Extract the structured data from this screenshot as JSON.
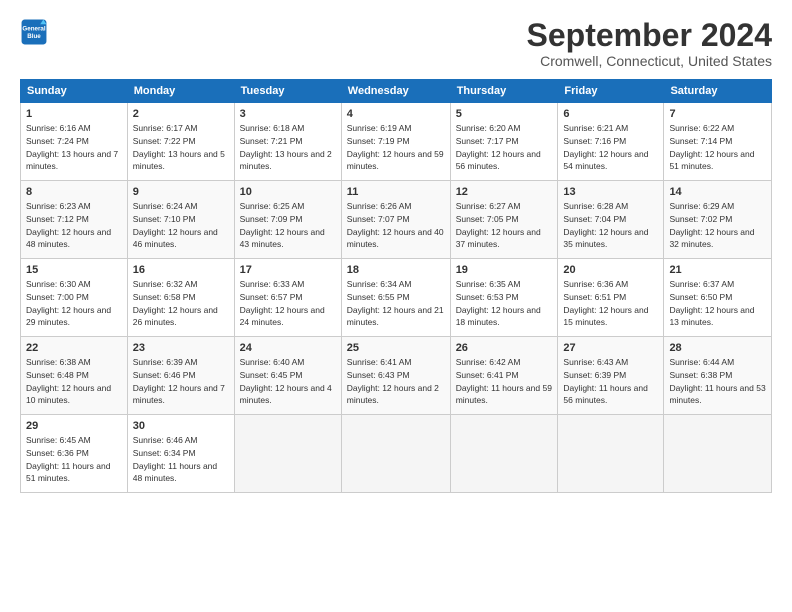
{
  "logo": {
    "line1": "General",
    "line2": "Blue"
  },
  "title": "September 2024",
  "subtitle": "Cromwell, Connecticut, United States",
  "days_of_week": [
    "Sunday",
    "Monday",
    "Tuesday",
    "Wednesday",
    "Thursday",
    "Friday",
    "Saturday"
  ],
  "weeks": [
    [
      {
        "day": "1",
        "sunrise": "6:16 AM",
        "sunset": "7:24 PM",
        "daylight": "13 hours and 7 minutes."
      },
      {
        "day": "2",
        "sunrise": "6:17 AM",
        "sunset": "7:22 PM",
        "daylight": "13 hours and 5 minutes."
      },
      {
        "day": "3",
        "sunrise": "6:18 AM",
        "sunset": "7:21 PM",
        "daylight": "13 hours and 2 minutes."
      },
      {
        "day": "4",
        "sunrise": "6:19 AM",
        "sunset": "7:19 PM",
        "daylight": "12 hours and 59 minutes."
      },
      {
        "day": "5",
        "sunrise": "6:20 AM",
        "sunset": "7:17 PM",
        "daylight": "12 hours and 56 minutes."
      },
      {
        "day": "6",
        "sunrise": "6:21 AM",
        "sunset": "7:16 PM",
        "daylight": "12 hours and 54 minutes."
      },
      {
        "day": "7",
        "sunrise": "6:22 AM",
        "sunset": "7:14 PM",
        "daylight": "12 hours and 51 minutes."
      }
    ],
    [
      {
        "day": "8",
        "sunrise": "6:23 AM",
        "sunset": "7:12 PM",
        "daylight": "12 hours and 48 minutes."
      },
      {
        "day": "9",
        "sunrise": "6:24 AM",
        "sunset": "7:10 PM",
        "daylight": "12 hours and 46 minutes."
      },
      {
        "day": "10",
        "sunrise": "6:25 AM",
        "sunset": "7:09 PM",
        "daylight": "12 hours and 43 minutes."
      },
      {
        "day": "11",
        "sunrise": "6:26 AM",
        "sunset": "7:07 PM",
        "daylight": "12 hours and 40 minutes."
      },
      {
        "day": "12",
        "sunrise": "6:27 AM",
        "sunset": "7:05 PM",
        "daylight": "12 hours and 37 minutes."
      },
      {
        "day": "13",
        "sunrise": "6:28 AM",
        "sunset": "7:04 PM",
        "daylight": "12 hours and 35 minutes."
      },
      {
        "day": "14",
        "sunrise": "6:29 AM",
        "sunset": "7:02 PM",
        "daylight": "12 hours and 32 minutes."
      }
    ],
    [
      {
        "day": "15",
        "sunrise": "6:30 AM",
        "sunset": "7:00 PM",
        "daylight": "12 hours and 29 minutes."
      },
      {
        "day": "16",
        "sunrise": "6:32 AM",
        "sunset": "6:58 PM",
        "daylight": "12 hours and 26 minutes."
      },
      {
        "day": "17",
        "sunrise": "6:33 AM",
        "sunset": "6:57 PM",
        "daylight": "12 hours and 24 minutes."
      },
      {
        "day": "18",
        "sunrise": "6:34 AM",
        "sunset": "6:55 PM",
        "daylight": "12 hours and 21 minutes."
      },
      {
        "day": "19",
        "sunrise": "6:35 AM",
        "sunset": "6:53 PM",
        "daylight": "12 hours and 18 minutes."
      },
      {
        "day": "20",
        "sunrise": "6:36 AM",
        "sunset": "6:51 PM",
        "daylight": "12 hours and 15 minutes."
      },
      {
        "day": "21",
        "sunrise": "6:37 AM",
        "sunset": "6:50 PM",
        "daylight": "12 hours and 13 minutes."
      }
    ],
    [
      {
        "day": "22",
        "sunrise": "6:38 AM",
        "sunset": "6:48 PM",
        "daylight": "12 hours and 10 minutes."
      },
      {
        "day": "23",
        "sunrise": "6:39 AM",
        "sunset": "6:46 PM",
        "daylight": "12 hours and 7 minutes."
      },
      {
        "day": "24",
        "sunrise": "6:40 AM",
        "sunset": "6:45 PM",
        "daylight": "12 hours and 4 minutes."
      },
      {
        "day": "25",
        "sunrise": "6:41 AM",
        "sunset": "6:43 PM",
        "daylight": "12 hours and 2 minutes."
      },
      {
        "day": "26",
        "sunrise": "6:42 AM",
        "sunset": "6:41 PM",
        "daylight": "11 hours and 59 minutes."
      },
      {
        "day": "27",
        "sunrise": "6:43 AM",
        "sunset": "6:39 PM",
        "daylight": "11 hours and 56 minutes."
      },
      {
        "day": "28",
        "sunrise": "6:44 AM",
        "sunset": "6:38 PM",
        "daylight": "11 hours and 53 minutes."
      }
    ],
    [
      {
        "day": "29",
        "sunrise": "6:45 AM",
        "sunset": "6:36 PM",
        "daylight": "11 hours and 51 minutes."
      },
      {
        "day": "30",
        "sunrise": "6:46 AM",
        "sunset": "6:34 PM",
        "daylight": "11 hours and 48 minutes."
      },
      null,
      null,
      null,
      null,
      null
    ]
  ],
  "labels": {
    "sunrise": "Sunrise:",
    "sunset": "Sunset:",
    "daylight": "Daylight:"
  }
}
